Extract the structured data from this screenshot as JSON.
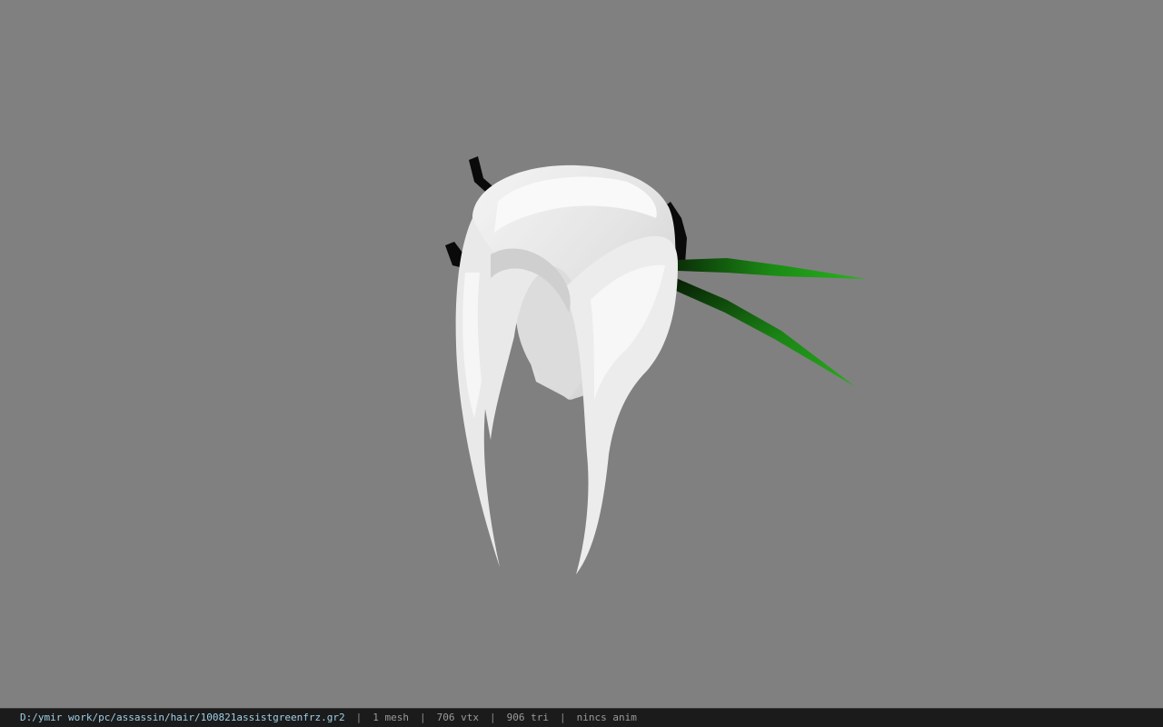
{
  "viewer": {
    "background_color": "#808080",
    "model": {
      "hair_color": "#e6e6e6",
      "pin_color": "#0a0a0a",
      "feather_color": "#1f8f17"
    }
  },
  "status_bar": {
    "file_path": "D:/ymir work/pc/assassin/hair/100821assistgreenfrz.gr2",
    "mesh_count": "1 mesh",
    "vertex_count": "706 vtx",
    "triangle_count": "906 tri",
    "anim_status": "nincs anim",
    "separator": "|"
  }
}
